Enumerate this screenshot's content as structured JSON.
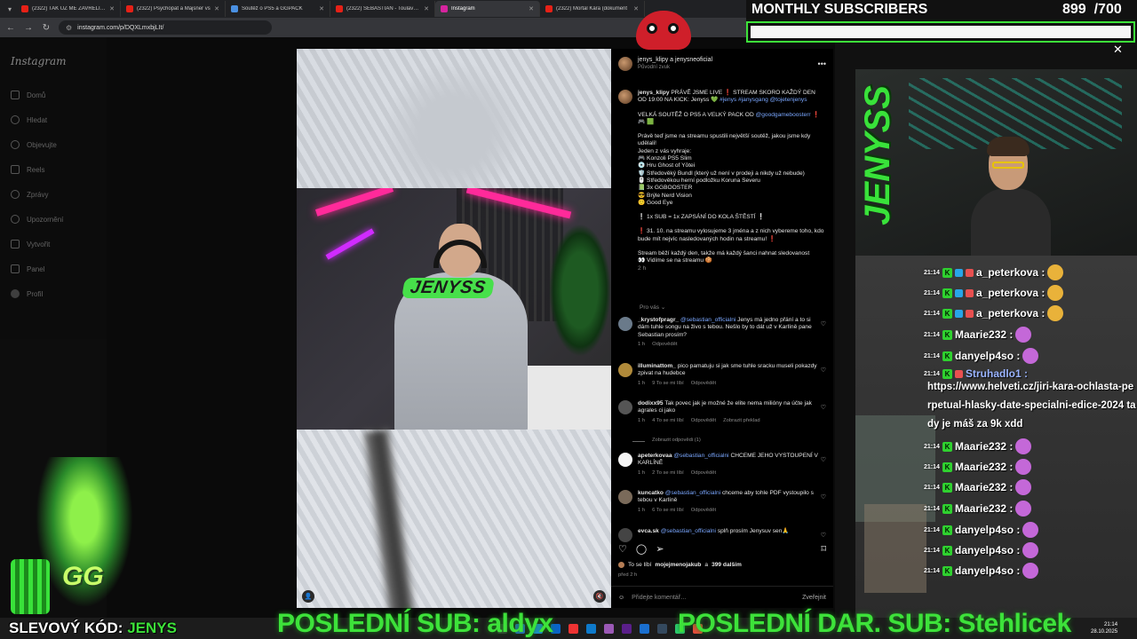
{
  "browser": {
    "tabs": [
      {
        "label": "(2322) TAK UŽ MĚ ZAVŘELI…",
        "favicon_color": "#e62117"
      },
      {
        "label": "(2322) Psychopat a Majsner vs",
        "favicon_color": "#e62117"
      },
      {
        "label": "Soutěž o PS5 a GGPACK",
        "favicon_color": "#4a90e2"
      },
      {
        "label": "(2322) SEBASTIAN - Toulavá (O",
        "favicon_color": "#e62117"
      },
      {
        "label": "Instagram",
        "favicon_color": "#d6249f",
        "active": true
      },
      {
        "label": "(2322) Mortal Kára (dokument",
        "favicon_color": "#e62117"
      }
    ],
    "url": "instagram.com/p/DQXLmxbjLIt/"
  },
  "instagram": {
    "logo": "Instagram",
    "sidebar": [
      {
        "label": "Domů",
        "icon": "home-icon"
      },
      {
        "label": "Hledat",
        "icon": "search-icon"
      },
      {
        "label": "Objevujte",
        "icon": "compass-icon"
      },
      {
        "label": "Reels",
        "icon": "reels-icon"
      },
      {
        "label": "Zprávy",
        "icon": "messages-icon"
      },
      {
        "label": "Upozornění",
        "icon": "heart-icon"
      },
      {
        "label": "Vytvořit",
        "icon": "plus-icon"
      },
      {
        "label": "Panel",
        "icon": "panel-icon"
      },
      {
        "label": "Profil",
        "icon": "profile-icon"
      }
    ],
    "video_brand": "JENYSS",
    "post": {
      "header_user": "jenys_klipy a jenysneoficial",
      "header_sub": "Původní zvuk",
      "caption_user": "jenys_klipy",
      "caption_first": "PRÁVĚ JSME LIVE ❗ STREAM SKORO KAŽDÝ DEN OD 19:00 NA KICK: Jenyss 💚",
      "caption_tags": "#jenys #janysgang @tojetenjenys",
      "caption_contest": "VELKÁ SOUTĚŽ O PS5 A VELKÝ PACK OD",
      "caption_contest_link": "@goodgameboosterr",
      "caption_contest_end": "❗",
      "caption_icons": "🎮 🟩",
      "caption_intro": "Právě teď jsme na streamu spustili největší soutěž, jakou jsme kdy udělali!",
      "caption_win": "Jeden z vás vyhraje:",
      "prizes": [
        "🎮 Konzoli PS5 Slim",
        "💿 Hru Ghost of Yōtei",
        "🛡️ Středověký Bundl (který už není v prodeji a nikdy už nebude)",
        "🖱️ Středověkou herní podložku Koruna Severu",
        "📗 3x GGBOOSTER",
        "😎 Brýle Nerd Vision",
        "🙂 Good Eye"
      ],
      "caption_rule": "❕ 1x SUB = 1x ZAPSÁNÍ DO KOLA ŠTĚSTÍ ❕",
      "caption_draw": "❗ 31. 10. na streamu vylosujeme 3 jména a z nich vybereme toho, kdo bude mít nejvíc nasledovaných hodin na streamu! ❗",
      "caption_end": "Stream běží každý den, takže má každý šanci nahnat sledovanost",
      "caption_end2": "👀 Vidíme se na streamu 🍪",
      "caption_time": "2 h",
      "for_you": "Pro vás ⌄",
      "comments": [
        {
          "user": "_krystofpragr_",
          "mention": "@sebastian_officialni",
          "text": "Jenys má jedno přání a to si dám tuhle songu na živo s tebou. Nešlo by to dát už v Karlíně pane Sebastian prosím?",
          "meta": [
            "1 h",
            "Odpovědět"
          ]
        },
        {
          "user": "illuminattom_",
          "mention": "",
          "text": "pico pamatuju si jak sme tuhle sracku museli pokazdy zpivat na hudebce",
          "meta": [
            "1 h",
            "9 To se mi líbí",
            "Odpovědět"
          ]
        },
        {
          "user": "dodixx95",
          "mention": "",
          "text": "Tak povec jak je možné že elite nema milióny na účte jak agrales ci jako",
          "meta": [
            "1 h",
            "4 To se mi líbí",
            "Odpovědět",
            "Zobrazit překlad"
          ]
        },
        {
          "user": "apeterkovaa",
          "mention": "@sebastian_officialni",
          "text": "CHCEME JEHO VYSTOUPENÍ V KARLÍNĚ",
          "meta": [
            "1 h",
            "2 To se mi líbí",
            "Odpovědět"
          ]
        },
        {
          "user": "kuncatko",
          "mention": "@sebastian_officialni",
          "text": "chceme aby tohle PDF vystoupilo s tebou v Karlíně",
          "meta": [
            "1 h",
            "6 To se mi líbí",
            "Odpovědět"
          ]
        },
        {
          "user": "evca.sk",
          "mention": "@sebastian_officialni",
          "text": "splň prosím Jenysuv sen🙏",
          "meta": []
        }
      ],
      "show_replies": "Zobrazit odpovědi (1)",
      "likes_prefix": "To se líbí",
      "likes_user": "mojejmenojakub",
      "likes_and": "a",
      "likes_count": "399 dalším",
      "likes_time": "před 2 h",
      "comment_placeholder": "Přidejte komentář…",
      "post_button": "Zveřejnit"
    }
  },
  "overlay": {
    "subs_title": "MONTHLY SUBSCRIBERS",
    "subs_current": "899",
    "subs_goal": "/700",
    "subs_progress": 1.0,
    "cam_brand": "JENYSS",
    "chat": [
      {
        "time": "21:14",
        "user": "a_peterkova :",
        "color": "#ffffff",
        "emote": "#e9b23a"
      },
      {
        "time": "21:14",
        "user": "a_peterkova :",
        "color": "#ffffff",
        "emote": "#e9b23a"
      },
      {
        "time": "21:14",
        "user": "a_peterkova :",
        "color": "#ffffff",
        "emote": "#e9b23a"
      },
      {
        "time": "21:14",
        "user": "Maarie232 :",
        "color": "#ffffff",
        "emote": "#c468d8"
      },
      {
        "time": "21:14",
        "user": "danyelp4so :",
        "color": "#ffffff",
        "emote": "#c468d8"
      },
      {
        "time": "21:14",
        "user": "Struhadlo1 :",
        "color": "#9ab4ff",
        "emote": ""
      },
      {
        "time": "21:14",
        "user": "Maarie232 :",
        "color": "#ffffff",
        "emote": "#c468d8"
      },
      {
        "time": "21:14",
        "user": "Maarie232 :",
        "color": "#ffffff",
        "emote": "#c468d8"
      },
      {
        "time": "21:14",
        "user": "Maarie232 :",
        "color": "#ffffff",
        "emote": "#c468d8"
      },
      {
        "time": "21:14",
        "user": "Maarie232 :",
        "color": "#ffffff",
        "emote": "#c468d8"
      },
      {
        "time": "21:14",
        "user": "danyelp4so :",
        "color": "#ffffff",
        "emote": "#c468d8"
      },
      {
        "time": "21:14",
        "user": "danyelp4so :",
        "color": "#ffffff",
        "emote": "#c468d8"
      },
      {
        "time": "21:14",
        "user": "danyelp4so :",
        "color": "#ffffff",
        "emote": "#c468d8"
      }
    ],
    "chat_link": "https://www.helveti.cz/jiri-kara-ochlasta-perpetual-hlasky-date-specialni-edice-2024 tady je máš za 9k xdd",
    "booster_logo": "GG",
    "promo_label": "SLEVOVÝ KÓD:",
    "promo_code": "JENYS",
    "last_sub": "POSLEDNÍ SUB: aldyx",
    "last_gift": "POSLEDNÍ DAR. SUB: Stehlicek",
    "clock_time": "21:14",
    "clock_date": "28.10.2025"
  },
  "colors": {
    "accent": "#3de23a",
    "link": "#7aa7ff"
  }
}
